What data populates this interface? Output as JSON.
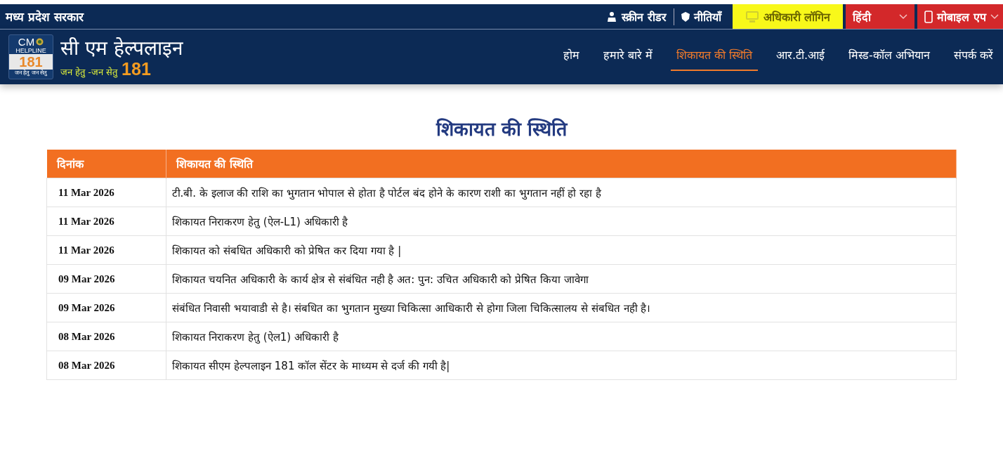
{
  "top_bar": {
    "state_name": "मध्य प्रदेश सरकार",
    "links": [
      {
        "kind": "reader",
        "label": "स्क्रीन रीडर"
      },
      {
        "kind": "policy",
        "label": "नीतियाँ"
      },
      {
        "kind": "login",
        "label": "अधिकारी लॉगिन"
      },
      {
        "kind": "language",
        "label": "हिंदी"
      },
      {
        "kind": "app",
        "label": "मोबाइल एप"
      }
    ]
  },
  "logo": {
    "badge_top": "CM",
    "badge_mid": "HELPLINE",
    "badge_number": "181",
    "badge_tagline": "जन हेतु जन सेतु",
    "title": "सी एम हेल्पलाइन",
    "tagline": "जन हेतु -जन सेतु",
    "number": "181"
  },
  "nav": [
    {
      "label": "होम",
      "selected": false
    },
    {
      "label": "हमारे बारे में",
      "selected": false
    },
    {
      "label": "शिकायत की स्थिति",
      "selected": true
    },
    {
      "label": "आर.टी.आई",
      "selected": false
    },
    {
      "label": "मिस्ड-कॉल अभियान",
      "selected": false
    },
    {
      "label": "संपर्क करें",
      "selected": false
    }
  ],
  "page_title": "शिकायत की स्थिति",
  "table": {
    "columns": [
      "दिनांक",
      "शिकायत की स्थिति"
    ],
    "rows": [
      {
        "date": "11 Mar 2026",
        "status": "टी.बी. के इलाज की राशि का भुगतान भोपाल से होता है पोर्टल बंद होने के कारण राशी का भुगतान नहीं हो रहा है"
      },
      {
        "date": "11 Mar 2026",
        "status": "शिकायत निराकरण हेतु (ऐल-L1) अधिकारी है"
      },
      {
        "date": "11 Mar 2026",
        "status": "शिकायत को संबधित अधिकारी को प्रेषित कर दिया गया है |"
      },
      {
        "date": "09 Mar 2026",
        "status": "शिकायत चयनित अधिकारी के कार्य क्षेत्र से संबंधित नही है अत: पुन: उचित अधिकारी को प्रेषित किया जावेगा"
      },
      {
        "date": "09 Mar 2026",
        "status": "संबंधित निवासी भयावाडी से है। संबधित का भुगतान मुख्या चिकित्सा आधिकारी से होगा जिला चिकित्सालय से संबधित नही है।"
      },
      {
        "date": "08 Mar 2026",
        "status": "शिकायत निराकरण हेतु (ऐल1) अधिकारी है"
      },
      {
        "date": "08 Mar 2026",
        "status": "शिकायत सीएम हेल्पलाइन 181 कॉल सेंटर के माध्यम से दर्ज की गयी है|"
      }
    ]
  }
}
